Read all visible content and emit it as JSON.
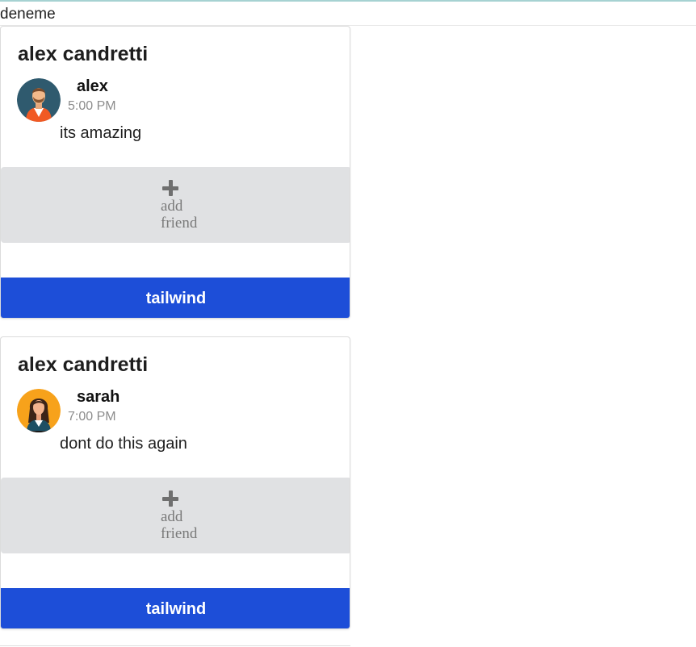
{
  "header": {
    "text": "deneme"
  },
  "cards": [
    {
      "title": "alex candretti",
      "author": "alex",
      "time": "5:00 PM",
      "message": "its amazing",
      "add_friend_label": "add friend",
      "button_label": "tailwind",
      "avatar_icon": "man-avatar-icon"
    },
    {
      "title": "alex candretti",
      "author": "sarah",
      "time": "7:00 PM",
      "message": "dont do this again",
      "add_friend_label": "add friend",
      "button_label": "tailwind",
      "avatar_icon": "woman-avatar-icon"
    }
  ],
  "colors": {
    "accent": "#1d4ed8",
    "add_friend_bg": "#e0e1e3",
    "muted_text": "#8c8c8c"
  }
}
